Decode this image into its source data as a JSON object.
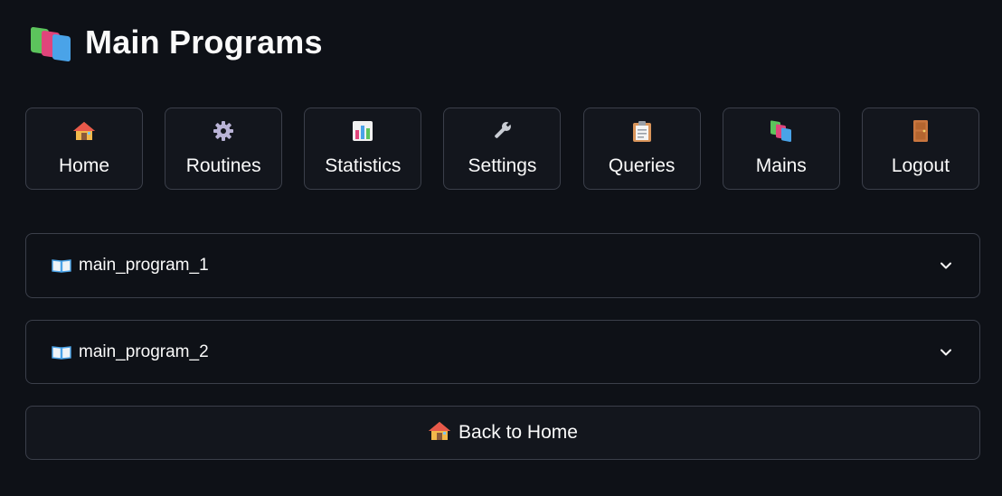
{
  "header": {
    "icon": "books-icon",
    "title": "Main Programs"
  },
  "nav": {
    "items": [
      {
        "label": "Home",
        "icon": "house-icon"
      },
      {
        "label": "Routines",
        "icon": "gear-icon"
      },
      {
        "label": "Statistics",
        "icon": "bar-chart-icon"
      },
      {
        "label": "Settings",
        "icon": "wrench-icon"
      },
      {
        "label": "Queries",
        "icon": "clipboard-icon"
      },
      {
        "label": "Mains",
        "icon": "books-icon"
      },
      {
        "label": "Logout",
        "icon": "door-icon"
      }
    ]
  },
  "expanders": [
    {
      "label": "main_program_1",
      "icon": "open-book-icon"
    },
    {
      "label": "main_program_2",
      "icon": "open-book-icon"
    }
  ],
  "back_button": {
    "label": "Back to Home",
    "icon": "house-icon"
  },
  "colors": {
    "background": "#0e1117",
    "border": "#3b3f4a",
    "text": "#fafafa"
  }
}
